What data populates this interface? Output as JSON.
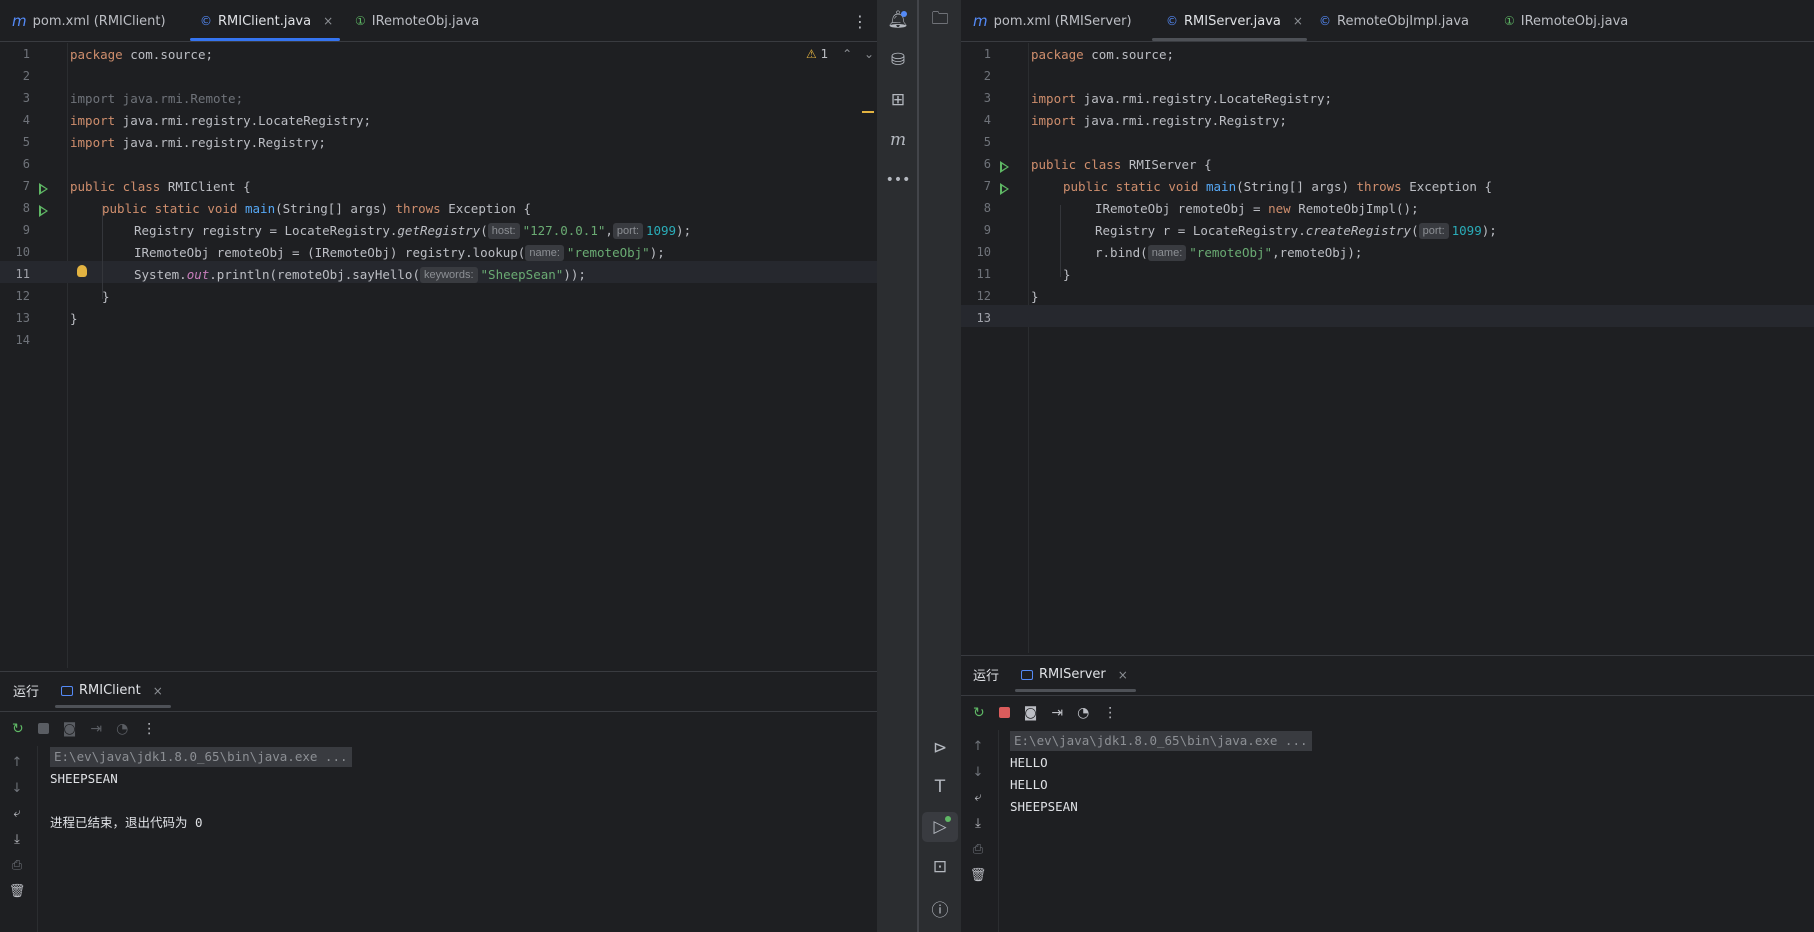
{
  "left": {
    "tabs": [
      {
        "icon": "m",
        "label": "pom.xml (RMIClient)"
      },
      {
        "icon": "©",
        "label": "RMIClient.java",
        "close": "×"
      },
      {
        "icon": "①",
        "label": "IRemoteObj.java"
      }
    ],
    "more": "⋮",
    "warnings": {
      "icon": "⚠",
      "count": "1"
    },
    "line_numbers": [
      "1",
      "2",
      "3",
      "4",
      "5",
      "6",
      "7",
      "8",
      "9",
      "10",
      "11",
      "12",
      "13",
      "14"
    ],
    "code": {
      "l1_kw": "package",
      "l1_rest": " com.source;",
      "l3": "import java.rmi.Remote;",
      "l4_kw": "import",
      "l4_rest": " java.rmi.registry.LocateRegistry;",
      "l5_kw": "import",
      "l5_rest": " java.rmi.registry.Registry;",
      "l7_kw": "public class",
      "l7_rest": " RMIClient {",
      "l8_kw1": "public static void",
      "l8_fn": "main",
      "l8_mid": "(String[] args) ",
      "l8_kw2": "throws",
      "l8_rest": " Exception {",
      "l9_a": "Registry registry = LocateRegistry.",
      "l9_fn": "getRegistry",
      "l9_b": "(",
      "l9_h1": "host:",
      "l9_s1": "\"127.0.0.1\"",
      "l9_c": ",",
      "l9_h2": "port:",
      "l9_n": "1099",
      "l9_d": ");",
      "l10_a": "IRemoteObj remoteObj = (IRemoteObj) registry.lookup(",
      "l10_h": "name:",
      "l10_s": "\"remoteObj\"",
      "l10_b": ");",
      "l11_a": "System.",
      "l11_out": "out",
      "l11_b": ".println(remoteObj.sayHello(",
      "l11_h": "keywords:",
      "l11_s": "\"SheepSean\"",
      "l11_c": "));",
      "l12": "}",
      "l13": "}"
    },
    "run": {
      "title": "运行",
      "tab": "RMIClient",
      "close": "×",
      "lines": [
        "E:\\ev\\java\\jdk1.8.0_65\\bin\\java.exe ...",
        "SHEEPSEAN",
        "",
        "进程已结束，退出代码为 0"
      ]
    }
  },
  "right": {
    "tabs": [
      {
        "icon": "m",
        "label": "pom.xml (RMIServer)"
      },
      {
        "icon": "©",
        "label": "RMIServer.java",
        "close": "×"
      },
      {
        "icon": "©",
        "label": "RemoteObjImpl.java"
      },
      {
        "icon": "①",
        "label": "IRemoteObj.java"
      }
    ],
    "line_numbers": [
      "1",
      "2",
      "3",
      "4",
      "5",
      "6",
      "7",
      "8",
      "9",
      "10",
      "11",
      "12",
      "13"
    ],
    "code": {
      "l1_kw": "package",
      "l1_rest": " com.source;",
      "l3_kw": "import",
      "l3_rest": " java.rmi.registry.LocateRegistry;",
      "l4_kw": "import",
      "l4_rest": " java.rmi.registry.Registry;",
      "l6_kw": "public class",
      "l6_rest": " RMIServer {",
      "l7_kw1": "public static void",
      "l7_fn": "main",
      "l7_mid": "(String[] args) ",
      "l7_kw2": "throws",
      "l7_rest": " Exception {",
      "l8_a": "IRemoteObj remoteObj = ",
      "l8_kw": "new",
      "l8_b": " RemoteObjImpl();",
      "l9_a": "Registry r = LocateRegistry.",
      "l9_fn": "createRegistry",
      "l9_b": "(",
      "l9_h": "port:",
      "l9_n": "1099",
      "l9_c": ");",
      "l10_a": "r.bind(",
      "l10_h": "name:",
      "l10_s": "\"remoteObj\"",
      "l10_b": ",remoteObj);",
      "l11": "}",
      "l12": "}"
    },
    "run": {
      "title": "运行",
      "tab": "RMIServer",
      "close": "×",
      "lines": [
        "E:\\ev\\java\\jdk1.8.0_65\\bin\\java.exe ...",
        "HELLO",
        "HELLO",
        "SHEEPSEAN"
      ]
    }
  }
}
